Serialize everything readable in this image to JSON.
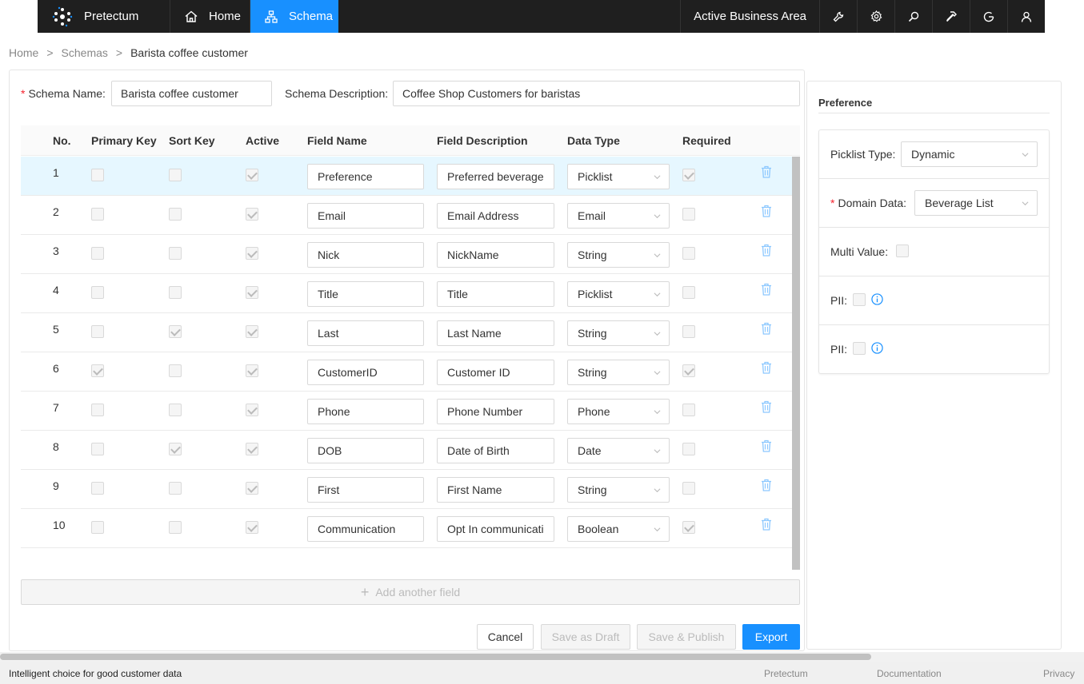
{
  "nav": {
    "brand": "Pretectum",
    "home": "Home",
    "schema": "Schema",
    "business_area": "Active Business Area",
    "icons": [
      "wrench-icon",
      "gear-icon",
      "search-icon",
      "hammer-icon",
      "refresh-icon",
      "user-icon"
    ]
  },
  "breadcrumb": {
    "home": "Home",
    "sep": ">",
    "schemas": "Schemas",
    "current": "Barista coffee customer"
  },
  "form": {
    "schema_name_label": "Schema Name",
    "schema_name_value": "Barista coffee customer",
    "schema_desc_label": "Schema Description",
    "schema_desc_value": "Coffee Shop Customers for baristas",
    "colon": ":"
  },
  "table": {
    "headers": [
      "No.",
      "Primary Key",
      "Sort Key",
      "Active",
      "Field Name",
      "Field Description",
      "Data Type",
      "Required"
    ],
    "rows": [
      {
        "no": "1",
        "pk": false,
        "sk": false,
        "active": true,
        "name": "Preference",
        "desc": "Preferred beverage",
        "type": "Picklist",
        "required": true
      },
      {
        "no": "2",
        "pk": false,
        "sk": false,
        "active": true,
        "name": "Email",
        "desc": "Email Address",
        "type": "Email",
        "required": false
      },
      {
        "no": "3",
        "pk": false,
        "sk": false,
        "active": true,
        "name": "Nick",
        "desc": "NickName",
        "type": "String",
        "required": false
      },
      {
        "no": "4",
        "pk": false,
        "sk": false,
        "active": true,
        "name": "Title",
        "desc": "Title",
        "type": "Picklist",
        "required": false
      },
      {
        "no": "5",
        "pk": false,
        "sk": true,
        "active": true,
        "name": "Last",
        "desc": "Last Name",
        "type": "String",
        "required": false
      },
      {
        "no": "6",
        "pk": true,
        "sk": false,
        "active": true,
        "name": "CustomerID",
        "desc": "Customer ID",
        "type": "String",
        "required": true
      },
      {
        "no": "7",
        "pk": false,
        "sk": false,
        "active": true,
        "name": "Phone",
        "desc": "Phone Number",
        "type": "Phone",
        "required": false
      },
      {
        "no": "8",
        "pk": false,
        "sk": true,
        "active": true,
        "name": "DOB",
        "desc": "Date of Birth",
        "type": "Date",
        "required": false
      },
      {
        "no": "9",
        "pk": false,
        "sk": false,
        "active": true,
        "name": "First",
        "desc": "First Name",
        "type": "String",
        "required": false
      },
      {
        "no": "10",
        "pk": false,
        "sk": false,
        "active": true,
        "name": "Communication",
        "desc": "Opt In communicati",
        "type": "Boolean",
        "required": true
      }
    ],
    "add_field": "Add another field"
  },
  "buttons": {
    "cancel": "Cancel",
    "save_draft": "Save as Draft",
    "save_publish": "Save & Publish",
    "export": "Export"
  },
  "side": {
    "title": "Preference",
    "picklist_type_label": "Picklist Type",
    "picklist_type_value": "Dynamic",
    "domain_data_label": "Domain Data",
    "domain_data_value": "Beverage List",
    "multi_value_label": "Multi Value",
    "pii_label_1": "PII",
    "pii_label_2": "PII"
  },
  "footer": {
    "tagline": "Intelligent choice for good customer data",
    "links": [
      "Pretectum",
      "Documentation",
      "Privacy"
    ]
  },
  "colors": {
    "accent": "#1890ff",
    "nav_bg": "#1f1f1f",
    "selected_row": "#e6f7ff"
  }
}
